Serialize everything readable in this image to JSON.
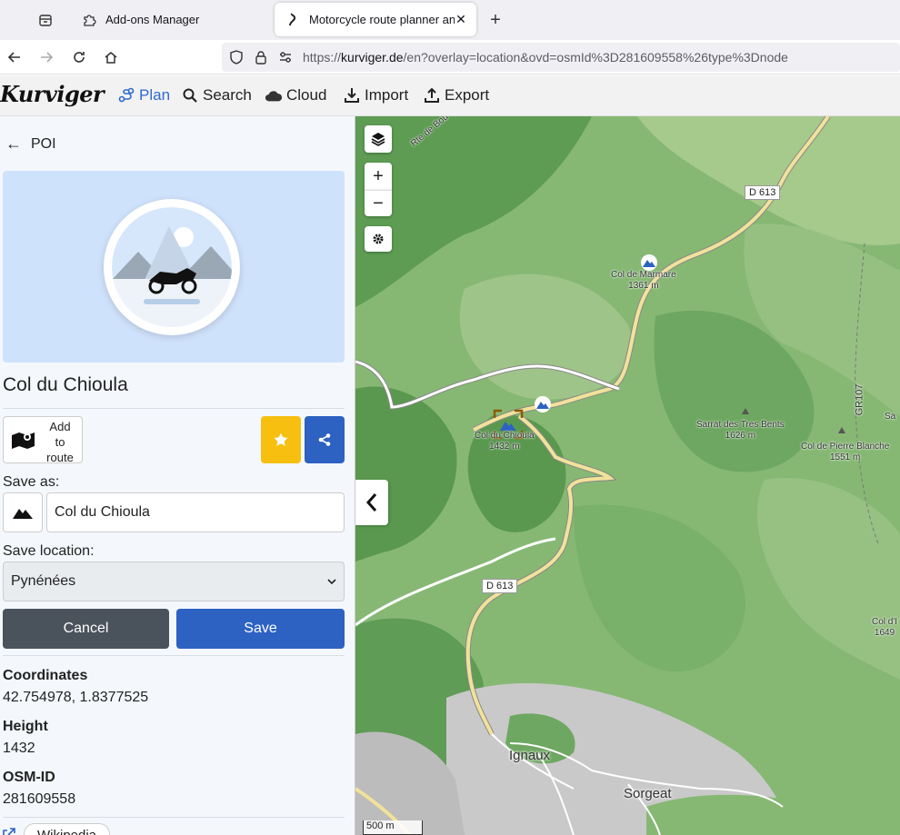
{
  "browser": {
    "tabs": [
      {
        "title": "Add-ons Manager",
        "icon": "puzzle-icon",
        "active": false
      },
      {
        "title": "Motorcycle route planner and n",
        "icon": "kurviger-icon",
        "active": true
      }
    ],
    "url_prefix": "https://",
    "url_host": "kurviger.de",
    "url_path": "/en?overlay=location&ovd=osmId%3D281609558%26type%3Dnode"
  },
  "app": {
    "logo": "Kurviger",
    "menu": [
      {
        "label": "Plan",
        "icon": "route-icon"
      },
      {
        "label": "Search",
        "icon": "search-icon"
      },
      {
        "label": "Cloud",
        "icon": "cloud-icon"
      },
      {
        "label": "Import",
        "icon": "import-icon"
      },
      {
        "label": "Export",
        "icon": "export-icon"
      }
    ]
  },
  "sidebar": {
    "back_label": "POI",
    "poi_title": "Col du Chioula",
    "add_to_route": "Add to route",
    "save_as_label": "Save as:",
    "save_as_value": "Col du Chioula",
    "save_location_label": "Save location:",
    "save_location_value": "Pynénées",
    "cancel_label": "Cancel",
    "save_label": "Save",
    "coordinates_label": "Coordinates",
    "coordinates_value": "42.754978, 1.8377525",
    "height_label": "Height",
    "height_value": "1432",
    "osm_label": "OSM-ID",
    "osm_value": "281609558",
    "wiki_label": "Wikipedia",
    "colors": {
      "favorite": "#f7c010",
      "primary": "#2d62c2",
      "cancel": "#4a525c"
    }
  },
  "map": {
    "labels": {
      "col_marmare": "Col de Marmare",
      "col_marmare_height": "1361 m",
      "col_chioula": "Col du Chioula",
      "col_chioula_height": "1432 m",
      "sarrat": "Sarrat des Tres Bents",
      "sarrat_height": "1626 m",
      "pierre": "Col de Pierre Blanche",
      "pierre_height": "1551 m",
      "road_d613_a": "D 613",
      "road_d613_b": "D 613",
      "gr107": "GR107",
      "town_ignaux": "Ignaux",
      "town_sorgeat": "Sorgeat",
      "edge_sa": "Sa",
      "edge_col": "Col d'I",
      "edge_col_h": "1649",
      "road_partial": "Rte de Bou"
    },
    "scale": "500 m"
  }
}
